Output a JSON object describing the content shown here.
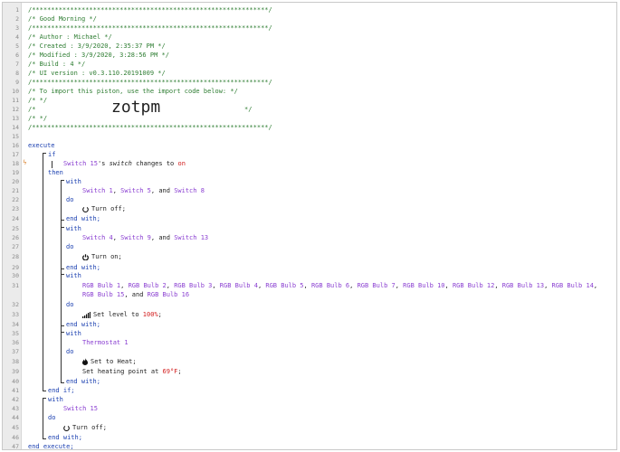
{
  "line_numbers": [
    "1",
    "2",
    "3",
    "4",
    "5",
    "6",
    "7",
    "8",
    "9",
    "10",
    "11",
    "12",
    "13",
    "14",
    "15",
    "16",
    "17",
    "18",
    "19",
    "20",
    "21",
    "22",
    "23",
    "24",
    "25",
    "26",
    "27",
    "28",
    "29",
    "30",
    "31",
    "32",
    "33",
    "34",
    "35",
    "36",
    "37",
    "38",
    "39",
    "40",
    "41",
    "42",
    "43",
    "44",
    "45",
    "46",
    "47",
    "48"
  ],
  "header": {
    "border": "/**************************************************************/",
    "title_line": "/* Good Morning                                               */",
    "author_line": "/* Author     : Michael                                      */",
    "created_line": "/* Created    : 3/9/2020, 2:35:37 PM                         */",
    "modified_line": "/* Modified   : 3/9/2020, 3:28:56 PM                         */",
    "build_line": "/* Build      : 4                                            */",
    "ui_line": "/* UI version : v0.3.110.20191009                             */",
    "import_line": "/* To import this piston, use the import code below:          */",
    "blank_line": "/*                                                            */",
    "code_prefix": "/*",
    "code_suffix": "*/",
    "import_code": "zotpm"
  },
  "code": {
    "execute": "execute",
    "end_execute": "end execute;",
    "if": "if",
    "then": "then",
    "end_if": "end if;",
    "with": "with",
    "do": "do",
    "end_with": "end with;",
    "and": "and",
    "cond_device": "Switch 15",
    "cond_possessive": "'s",
    "cond_attr": "switch",
    "cond_changes": "changes to",
    "cond_value": "on",
    "group1_devices_a": "Switch 1",
    "group1_devices_b": "Switch 5",
    "group1_devices_c": "Switch 8",
    "group1_action": "Turn off;",
    "group2_devices_a": "Switch 4",
    "group2_devices_b": "Switch 9",
    "group2_devices_c": "Switch 13",
    "group2_action": "Turn on;",
    "bulbs_line1": [
      "RGB Bulb 1",
      "RGB Bulb 2",
      "RGB Bulb 3",
      "RGB Bulb 4",
      "RGB Bulb 5",
      "RGB Bulb 6",
      "RGB Bulb 7",
      "RGB Bulb 10",
      "RGB Bulb 12",
      "RGB Bulb 13",
      "RGB Bulb 14"
    ],
    "bulbs_line2_a": "RGB Bulb 15",
    "bulbs_line2_b": "RGB Bulb 16",
    "level_action": "Set level to",
    "level_value": "100%",
    "thermostat": "Thermostat 1",
    "thermo_action1": "Set to Heat;",
    "thermo_action2": "Set heating point at",
    "thermo_value": "69°F",
    "outer_device": "Switch 15",
    "outer_action": "Turn off;"
  },
  "colors": {
    "comment": "#2e7d32",
    "keyword": "#1a3fb0",
    "device": "#8a3fd1",
    "value": "#d21c1c"
  }
}
